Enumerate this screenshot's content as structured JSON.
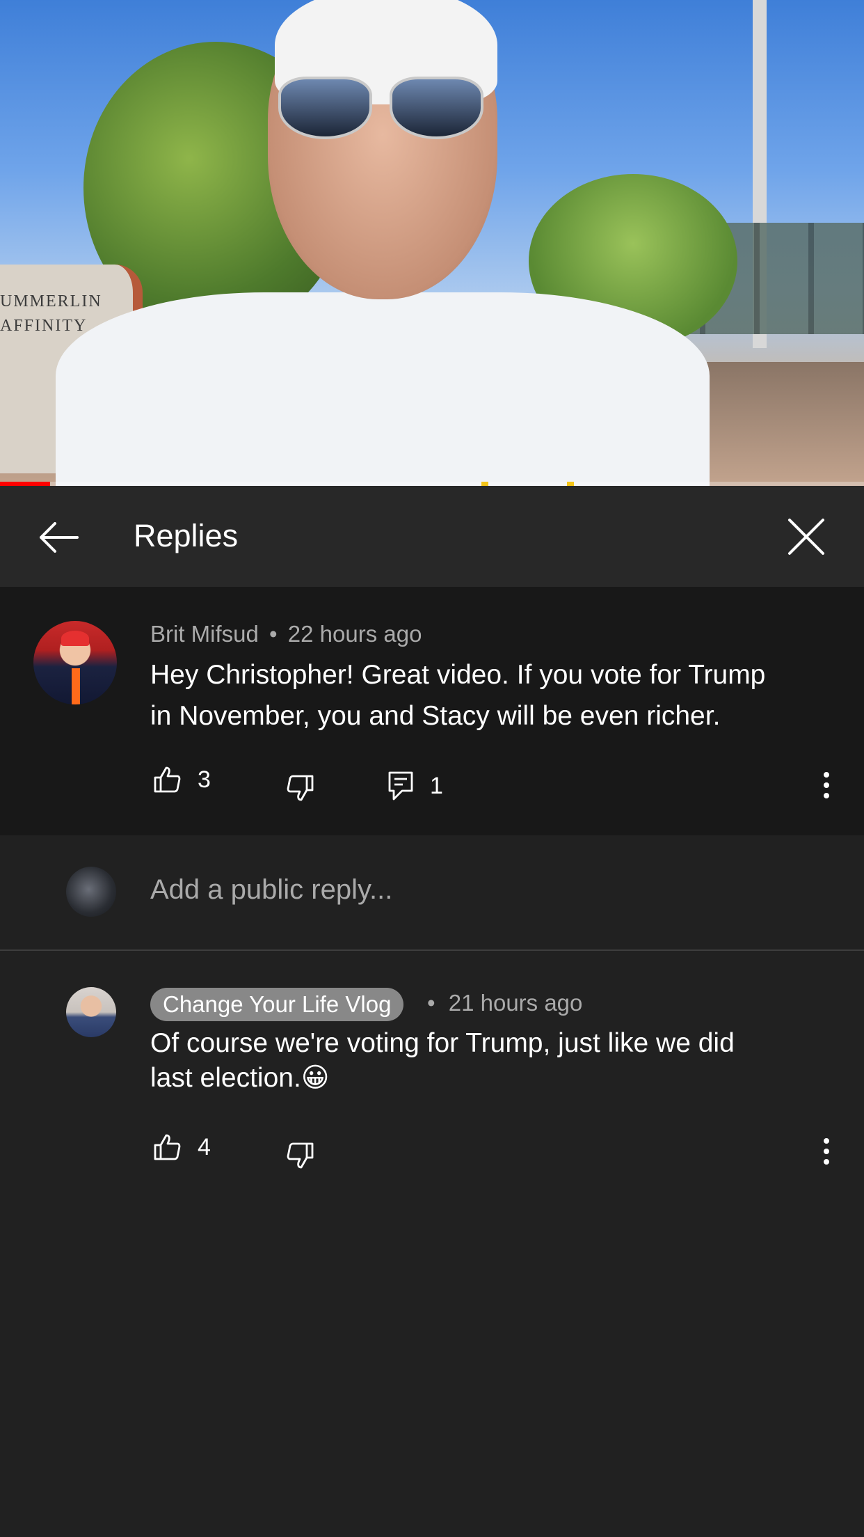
{
  "video": {
    "sign_line1": "UMMERLIN",
    "sign_line2": "AFFINITY"
  },
  "header": {
    "title": "Replies",
    "back_icon": "arrow-left-icon",
    "close_icon": "close-icon"
  },
  "comment": {
    "author": "Brit Mifsud",
    "separator": "•",
    "time": "22 hours ago",
    "text_line1": "Hey Christopher! Great video. If you vote for Trump",
    "text_line2": "in November, you and Stacy will be even richer.",
    "likes": "3",
    "replies": "1"
  },
  "reply_box": {
    "placeholder": "Add a public reply..."
  },
  "reply": {
    "author": "Change Your Life Vlog",
    "separator": "•",
    "time": "21 hours ago",
    "text_line1": "Of course we're voting for Trump, just like we did",
    "text_line2": "last election.",
    "emoji": "😀",
    "likes": "4"
  },
  "colors": {
    "background": "#212121",
    "header": "#282828",
    "comment_bg": "#181818",
    "meta_text": "#aaaaaa",
    "progress": "#ff0000",
    "badge": "#888888"
  }
}
